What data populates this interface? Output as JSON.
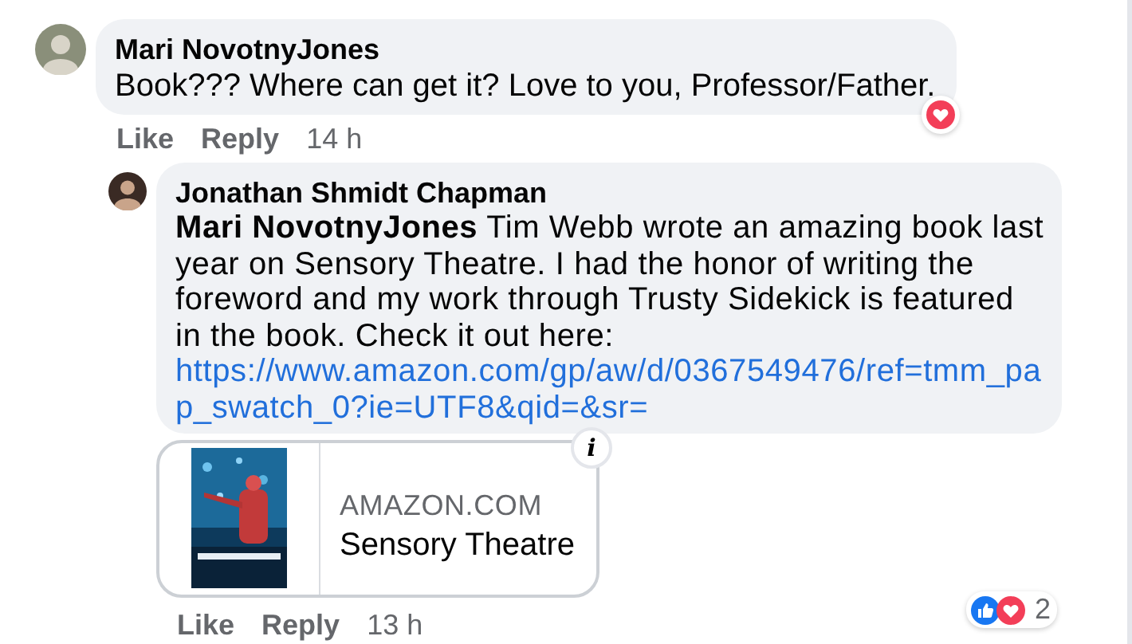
{
  "comment": {
    "author": "Mari NovotnyJones",
    "text": "Book??? Where can get it? Love to you, Professor/Father.",
    "reactions": [
      {
        "kind": "love"
      }
    ],
    "actions": {
      "like": "Like",
      "reply": "Reply",
      "time": "14 h"
    }
  },
  "reply": {
    "author": "Jonathan Shmidt Chapman",
    "text": "**Mari NovotnyJones** Tim Webb wrote an amazing book last year on Sensory Theatre. I had the honor of writing the foreword and my work through Trusty Sidekick is featured in the book. Check it out here:",
    "link": "https://www.amazon.com/gp/aw/d/0367549476/ref=tmm_pap_swatch_0?ie=UTF8&qid=&sr=",
    "link_preview": {
      "domain": "AMAZON.COM",
      "title": "Sensory Theatre",
      "info": "i"
    },
    "reactions": [
      {
        "kind": "like"
      },
      {
        "kind": "love"
      }
    ],
    "reaction_count": "2",
    "actions": {
      "like": "Like",
      "reply": "Reply",
      "time": "13 h"
    }
  }
}
